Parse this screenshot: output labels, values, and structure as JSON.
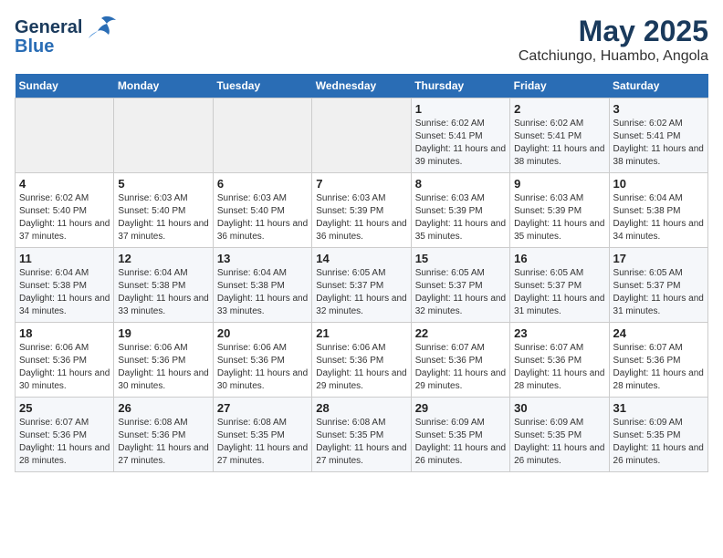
{
  "header": {
    "logo_line1": "General",
    "logo_line2": "Blue",
    "title": "May 2025",
    "subtitle": "Catchiungo, Huambo, Angola"
  },
  "days_of_week": [
    "Sunday",
    "Monday",
    "Tuesday",
    "Wednesday",
    "Thursday",
    "Friday",
    "Saturday"
  ],
  "weeks": [
    [
      {
        "day": "",
        "info": ""
      },
      {
        "day": "",
        "info": ""
      },
      {
        "day": "",
        "info": ""
      },
      {
        "day": "",
        "info": ""
      },
      {
        "day": "1",
        "info": "Sunrise: 6:02 AM\nSunset: 5:41 PM\nDaylight: 11 hours and 39 minutes."
      },
      {
        "day": "2",
        "info": "Sunrise: 6:02 AM\nSunset: 5:41 PM\nDaylight: 11 hours and 38 minutes."
      },
      {
        "day": "3",
        "info": "Sunrise: 6:02 AM\nSunset: 5:41 PM\nDaylight: 11 hours and 38 minutes."
      }
    ],
    [
      {
        "day": "4",
        "info": "Sunrise: 6:02 AM\nSunset: 5:40 PM\nDaylight: 11 hours and 37 minutes."
      },
      {
        "day": "5",
        "info": "Sunrise: 6:03 AM\nSunset: 5:40 PM\nDaylight: 11 hours and 37 minutes."
      },
      {
        "day": "6",
        "info": "Sunrise: 6:03 AM\nSunset: 5:40 PM\nDaylight: 11 hours and 36 minutes."
      },
      {
        "day": "7",
        "info": "Sunrise: 6:03 AM\nSunset: 5:39 PM\nDaylight: 11 hours and 36 minutes."
      },
      {
        "day": "8",
        "info": "Sunrise: 6:03 AM\nSunset: 5:39 PM\nDaylight: 11 hours and 35 minutes."
      },
      {
        "day": "9",
        "info": "Sunrise: 6:03 AM\nSunset: 5:39 PM\nDaylight: 11 hours and 35 minutes."
      },
      {
        "day": "10",
        "info": "Sunrise: 6:04 AM\nSunset: 5:38 PM\nDaylight: 11 hours and 34 minutes."
      }
    ],
    [
      {
        "day": "11",
        "info": "Sunrise: 6:04 AM\nSunset: 5:38 PM\nDaylight: 11 hours and 34 minutes."
      },
      {
        "day": "12",
        "info": "Sunrise: 6:04 AM\nSunset: 5:38 PM\nDaylight: 11 hours and 33 minutes."
      },
      {
        "day": "13",
        "info": "Sunrise: 6:04 AM\nSunset: 5:38 PM\nDaylight: 11 hours and 33 minutes."
      },
      {
        "day": "14",
        "info": "Sunrise: 6:05 AM\nSunset: 5:37 PM\nDaylight: 11 hours and 32 minutes."
      },
      {
        "day": "15",
        "info": "Sunrise: 6:05 AM\nSunset: 5:37 PM\nDaylight: 11 hours and 32 minutes."
      },
      {
        "day": "16",
        "info": "Sunrise: 6:05 AM\nSunset: 5:37 PM\nDaylight: 11 hours and 31 minutes."
      },
      {
        "day": "17",
        "info": "Sunrise: 6:05 AM\nSunset: 5:37 PM\nDaylight: 11 hours and 31 minutes."
      }
    ],
    [
      {
        "day": "18",
        "info": "Sunrise: 6:06 AM\nSunset: 5:36 PM\nDaylight: 11 hours and 30 minutes."
      },
      {
        "day": "19",
        "info": "Sunrise: 6:06 AM\nSunset: 5:36 PM\nDaylight: 11 hours and 30 minutes."
      },
      {
        "day": "20",
        "info": "Sunrise: 6:06 AM\nSunset: 5:36 PM\nDaylight: 11 hours and 30 minutes."
      },
      {
        "day": "21",
        "info": "Sunrise: 6:06 AM\nSunset: 5:36 PM\nDaylight: 11 hours and 29 minutes."
      },
      {
        "day": "22",
        "info": "Sunrise: 6:07 AM\nSunset: 5:36 PM\nDaylight: 11 hours and 29 minutes."
      },
      {
        "day": "23",
        "info": "Sunrise: 6:07 AM\nSunset: 5:36 PM\nDaylight: 11 hours and 28 minutes."
      },
      {
        "day": "24",
        "info": "Sunrise: 6:07 AM\nSunset: 5:36 PM\nDaylight: 11 hours and 28 minutes."
      }
    ],
    [
      {
        "day": "25",
        "info": "Sunrise: 6:07 AM\nSunset: 5:36 PM\nDaylight: 11 hours and 28 minutes."
      },
      {
        "day": "26",
        "info": "Sunrise: 6:08 AM\nSunset: 5:36 PM\nDaylight: 11 hours and 27 minutes."
      },
      {
        "day": "27",
        "info": "Sunrise: 6:08 AM\nSunset: 5:35 PM\nDaylight: 11 hours and 27 minutes."
      },
      {
        "day": "28",
        "info": "Sunrise: 6:08 AM\nSunset: 5:35 PM\nDaylight: 11 hours and 27 minutes."
      },
      {
        "day": "29",
        "info": "Sunrise: 6:09 AM\nSunset: 5:35 PM\nDaylight: 11 hours and 26 minutes."
      },
      {
        "day": "30",
        "info": "Sunrise: 6:09 AM\nSunset: 5:35 PM\nDaylight: 11 hours and 26 minutes."
      },
      {
        "day": "31",
        "info": "Sunrise: 6:09 AM\nSunset: 5:35 PM\nDaylight: 11 hours and 26 minutes."
      }
    ]
  ]
}
